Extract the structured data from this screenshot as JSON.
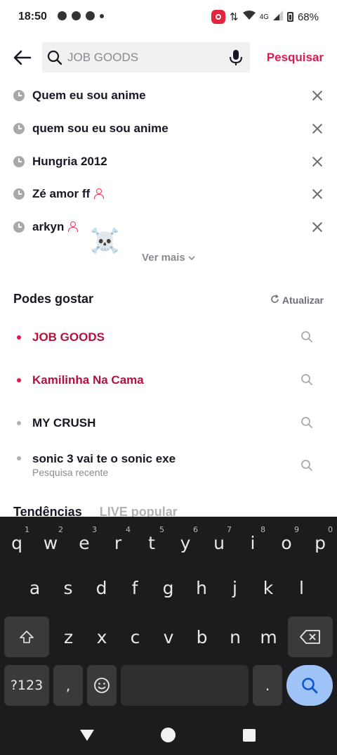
{
  "status": {
    "time": "18:50",
    "network": "4G",
    "battery": "68%"
  },
  "search": {
    "placeholder": "JOB GOODS",
    "button_label": "Pesquisar"
  },
  "history": [
    {
      "text": "Quem eu sou anime",
      "user": false
    },
    {
      "text": "quem sou eu sou anime",
      "user": false
    },
    {
      "text": "Hungria 2012",
      "user": false
    },
    {
      "text": "Zé amor ff",
      "user": true
    },
    {
      "text": "arkyn",
      "user": true
    }
  ],
  "emoji": "☠️",
  "see_more": "Ver mais",
  "suggestions": {
    "title": "Podes gostar",
    "refresh_label": "Atualizar",
    "items": [
      {
        "text": "JOB GOODS",
        "highlight": true,
        "sub": ""
      },
      {
        "text": "Kamilinha Na Cama",
        "highlight": true,
        "sub": ""
      },
      {
        "text": "MY CRUSH",
        "highlight": false,
        "sub": ""
      },
      {
        "text": "sonic 3 vai te o sonic exe",
        "highlight": false,
        "sub": "Pesquisa recente"
      }
    ]
  },
  "tabs": [
    "Tendências",
    "LIVE popular"
  ],
  "keyboard": {
    "row1": [
      {
        "k": "q",
        "n": "1"
      },
      {
        "k": "w",
        "n": "2"
      },
      {
        "k": "e",
        "n": "3"
      },
      {
        "k": "r",
        "n": "4"
      },
      {
        "k": "t",
        "n": "5"
      },
      {
        "k": "y",
        "n": "6"
      },
      {
        "k": "u",
        "n": "7"
      },
      {
        "k": "i",
        "n": "8"
      },
      {
        "k": "o",
        "n": "9"
      },
      {
        "k": "p",
        "n": "0"
      }
    ],
    "row2": [
      "a",
      "s",
      "d",
      "f",
      "g",
      "h",
      "j",
      "k",
      "l"
    ],
    "row3": [
      "z",
      "x",
      "c",
      "v",
      "b",
      "n",
      "m"
    ],
    "symbols_label": "?123",
    "comma": ",",
    "period": "."
  },
  "colors": {
    "accent": "#e2194f",
    "highlight_text": "#b3113e",
    "keyboard_bg": "#1c1c1e",
    "enter_key": "#9fc3f7"
  }
}
